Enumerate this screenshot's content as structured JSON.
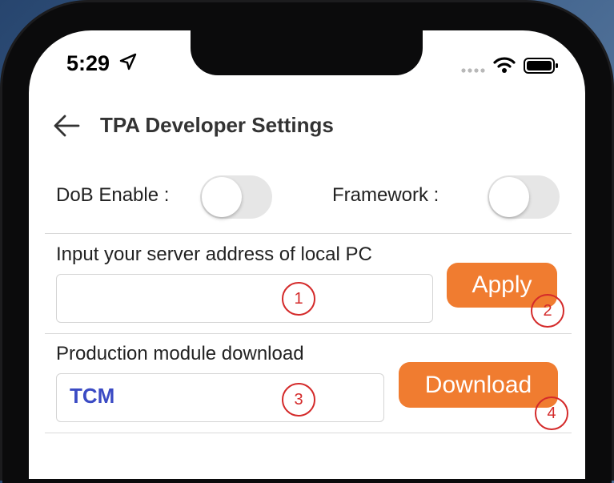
{
  "status_bar": {
    "time": "5:29"
  },
  "header": {
    "title": "TPA Developer Settings"
  },
  "settings": {
    "dob_label": "DoB Enable :",
    "dob_enabled": false,
    "framework_label": "Framework :",
    "framework_enabled": false
  },
  "server": {
    "label": "Input your server address of local PC",
    "value": "",
    "apply_label": "Apply"
  },
  "production": {
    "label": "Production module download",
    "value": "TCM",
    "download_label": "Download"
  },
  "annotations": [
    "1",
    "2",
    "3",
    "4"
  ],
  "colors": {
    "accent": "#f07c30",
    "annotation": "#d42a2a",
    "value_text": "#3b4bc4"
  },
  "icons": [
    "location-arrow-icon",
    "signal-icon",
    "wifi-icon",
    "battery-icon",
    "back-arrow-icon"
  ]
}
